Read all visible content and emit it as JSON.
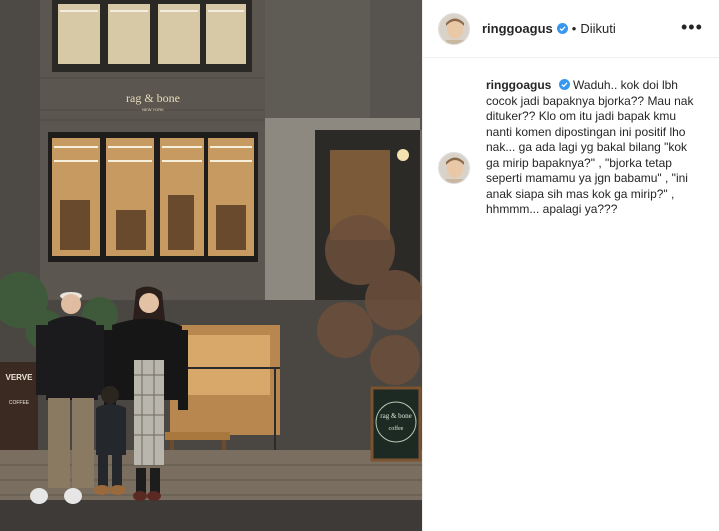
{
  "post": {
    "username": "ringgoagus",
    "follow_status": "Diikuti",
    "separator": "•",
    "more_icon": "more-horizontal-icon",
    "caption": "Waduh.. kok doi lbh cocok jadi bapaknya bjorka?? Mau nak dituker?? Klo om itu jadi bapak kmu nanti komen dipostingan ini positif lho nak... ga ada lagi yg bakal bilang \"kok ga mirip bapaknya?\" , \"bjorka tetap seperti mamamu ya jgn babamu\" , \"ini anak siapa sih mas kok ga mirip?\" , hhmmm... apalagi ya???"
  },
  "photo": {
    "store_sign": "rag & bone",
    "store_sign_sub": "NEW YORK",
    "side_sign": "VERVE",
    "side_sign_item": "COFFEE",
    "chalkboard_text": "rag & bone",
    "chalkboard_sub": "coffee"
  },
  "colors": {
    "verified": "#3897f0",
    "text": "#262626",
    "divider": "#efefef"
  }
}
